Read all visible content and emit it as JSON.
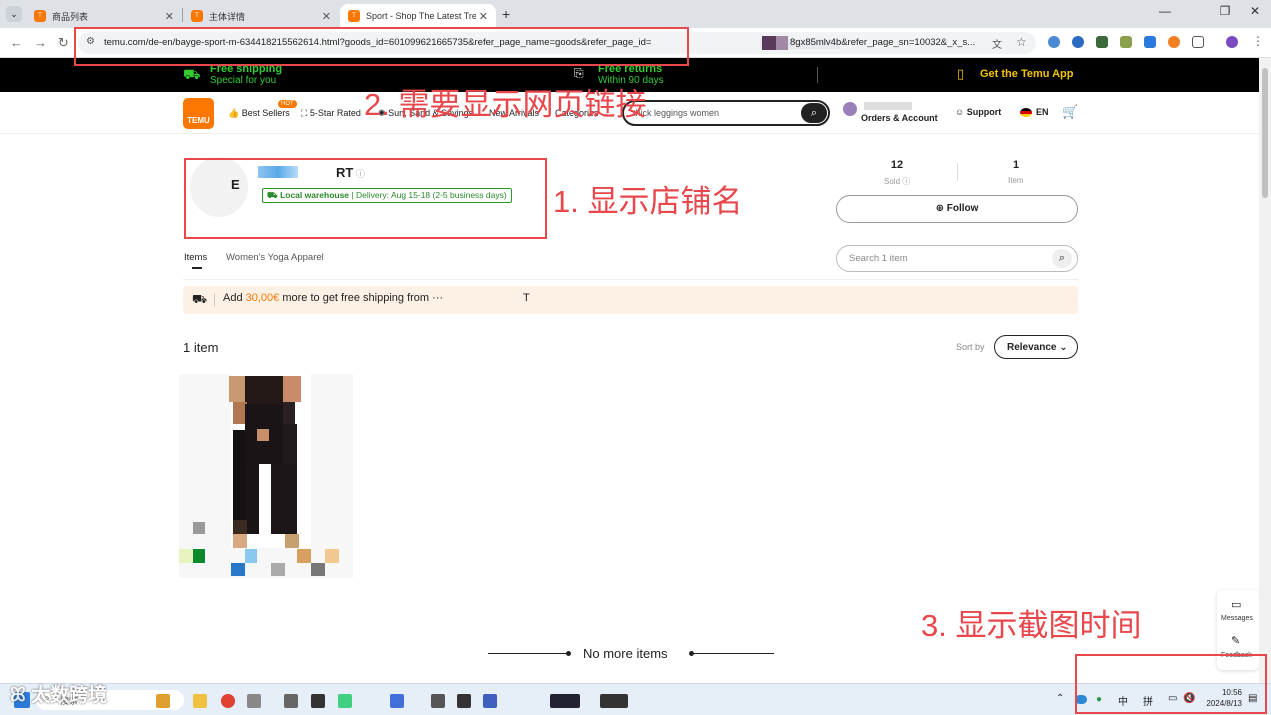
{
  "browser": {
    "tabs": [
      {
        "title": "商品列表"
      },
      {
        "title": "主体详情"
      },
      {
        "title": "Sport - Shop The Latest Tren"
      }
    ],
    "url": "temu.com/de-en/bayge-sport-m-634418215562614.html?goods_id=601099621665735&refer_page_name=goods&refer_page_id=",
    "url_tail": "8gx85mlv4b&refer_page_sn=10032&_x_s...",
    "window_controls": {
      "minimize": "—",
      "restore": "❐",
      "close": "✕"
    }
  },
  "promo": {
    "shipping_title": "Free shipping",
    "shipping_sub": "Special for you",
    "returns_title": "Free returns",
    "returns_sub": "Within 90 days",
    "app": "Get the Temu App"
  },
  "header": {
    "logo_text": "TEMU",
    "hot_badge": "HOT",
    "nav": [
      "Best Sellers",
      "5-Star Rated",
      "Sun, Sand & Savings",
      "New Arrivals",
      "Categories"
    ],
    "search_placeholder": "thick leggings women",
    "orders": "Orders & Account",
    "support": "Support",
    "lang": "EN"
  },
  "store": {
    "name_suffix": "RT",
    "avatar_letter": "E",
    "warehouse": "Local warehouse",
    "delivery": "Delivery: Aug 15-18 (2-5 business days)",
    "sold_value": "12",
    "sold_label": "Sold",
    "items_value": "1",
    "items_label": "Item",
    "follow": "Follow"
  },
  "tabs": {
    "items": "Items",
    "category": "Women's Yoga Apparel"
  },
  "store_search": "Search 1 item",
  "shipping_banner": {
    "pre": "Add ",
    "amount": "30,00€",
    "post": " more to get free shipping from ···",
    "tail": "T"
  },
  "listing": {
    "count": "1 item",
    "sort_label": "Sort by",
    "sort_value": "Relevance",
    "no_more": "No more items"
  },
  "annotations": {
    "a1": "1. 显示店铺名",
    "a2": "2. 需要显示网页链接",
    "a3": "3. 显示截图时间"
  },
  "side_panel": {
    "messages": "Messages",
    "feedback": "Feedback"
  },
  "taskbar": {
    "search": "搜索",
    "ime_lang": "中",
    "ime_mode": "拼",
    "time": "10:56",
    "date": "2024/8/13",
    "watermark": "太数跨境"
  },
  "colors": {
    "brand": "#fb7701",
    "annotation": "#e8474c",
    "promo_green": "#33cc33"
  }
}
